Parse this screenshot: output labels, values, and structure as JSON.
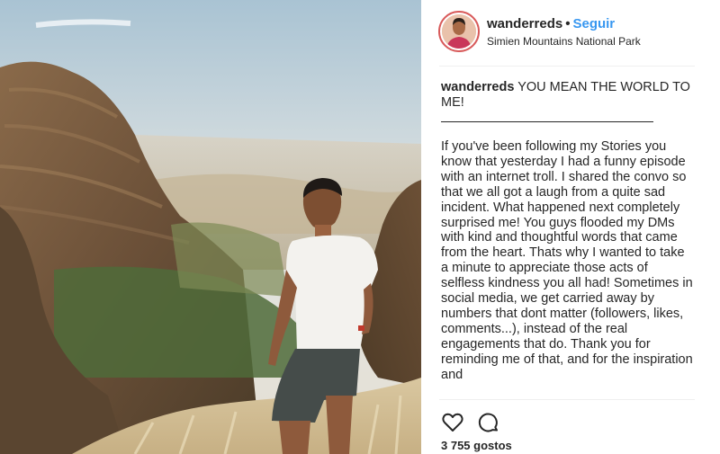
{
  "post": {
    "photo_icon": "mountain-hiker-photo",
    "username": "wanderreds",
    "separator": "•",
    "follow_label": "Seguir",
    "location": "Simien Mountains National Park",
    "avatar_icon": "profile-avatar",
    "ring_color": "#d85a5a",
    "follow_color": "#3897f0"
  },
  "caption": {
    "username": "wanderreds",
    "title": "YOU MEAN THE WORLD TO ME!",
    "body": "If you've been following my Stories you know that yesterday I had a funny episode with an internet troll. I shared the convo so that we all got a laugh from a quite sad incident. What happened next completely surprised me! You guys flooded my DMs with kind and thoughtful words that came from the heart. Thats why I wanted to take a minute to appreciate those acts of selfless kindness you all had! Sometimes in social media, we get carried away by numbers that dont matter (followers, likes, comments...), instead of the real engagements that do. Thank you for reminding me of that, and for the inspiration and"
  },
  "actions": {
    "like_icon": "heart-icon",
    "comment_icon": "comment-icon",
    "likes_label": "3 755 gostos"
  }
}
